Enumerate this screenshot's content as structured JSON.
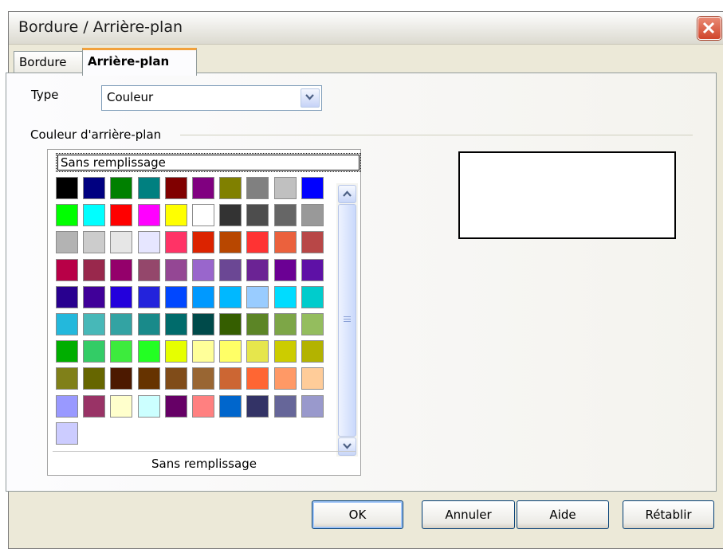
{
  "window": {
    "title": "Bordure / Arrière-plan"
  },
  "tabs": [
    {
      "label": "Bordure",
      "active": false
    },
    {
      "label": "Arrière-plan",
      "active": true
    }
  ],
  "type_field": {
    "label": "Type",
    "value": "Couleur"
  },
  "background_group": {
    "label": "Couleur d'arrière-plan"
  },
  "palette": {
    "selected_label": "Sans remplissage",
    "status_text": "Sans remplissage",
    "colors": [
      "#000000",
      "#000080",
      "#008000",
      "#008080",
      "#800000",
      "#800080",
      "#808000",
      "#808080",
      "#c0c0c0",
      "#0000ff",
      "#00ff00",
      "#00ffff",
      "#ff0000",
      "#ff00ff",
      "#ffff00",
      "#ffffff",
      "#333333",
      "#4d4d4d",
      "#666666",
      "#999999",
      "#b3b3b3",
      "#cccccc",
      "#e6e6e6",
      "#e6e6ff",
      "#ff3366",
      "#dc2300",
      "#b84700",
      "#ff3333",
      "#eb613d",
      "#b84747",
      "#b80047",
      "#99284c",
      "#94006b",
      "#94476b",
      "#944794",
      "#9966cc",
      "#6b4794",
      "#6b2394",
      "#6b0094",
      "#5e11a6",
      "#28008f",
      "#400099",
      "#2300dc",
      "#2323dc",
      "#0047ff",
      "#0099ff",
      "#00b8ff",
      "#99ccff",
      "#00dcff",
      "#00cccc",
      "#23b8dc",
      "#47b8b8",
      "#33a3a3",
      "#198a8a",
      "#006b6b",
      "#004a4a",
      "#355e00",
      "#5c8526",
      "#7da647",
      "#94bd5e",
      "#00ae00",
      "#33cc66",
      "#3deb3d",
      "#23ff23",
      "#e6ff00",
      "#ffff99",
      "#ffff66",
      "#e6e64c",
      "#cccc00",
      "#b3b300",
      "#808019",
      "#666600",
      "#4c1900",
      "#663300",
      "#804c19",
      "#996633",
      "#cc6633",
      "#ff6633",
      "#ff9966",
      "#ffcc99",
      "#9999ff",
      "#993366",
      "#ffffcc",
      "#ccffff",
      "#660066",
      "#ff8080",
      "#0066cc",
      "#333366",
      "#666699",
      "#9999cc",
      "#ccccff"
    ]
  },
  "buttons": {
    "ok": "OK",
    "annuler": "Annuler",
    "aide": "Aide",
    "retablir": "Rétablir"
  },
  "icons": {
    "close": "close-icon",
    "dropdown": "chevron-down-icon",
    "scroll_up": "chevron-up-icon",
    "scroll_down": "chevron-down-icon"
  },
  "colors": {
    "tab_accent": "#f2a13b",
    "close_button": "#d0452b",
    "dialog_bg": "#ece9d8"
  }
}
